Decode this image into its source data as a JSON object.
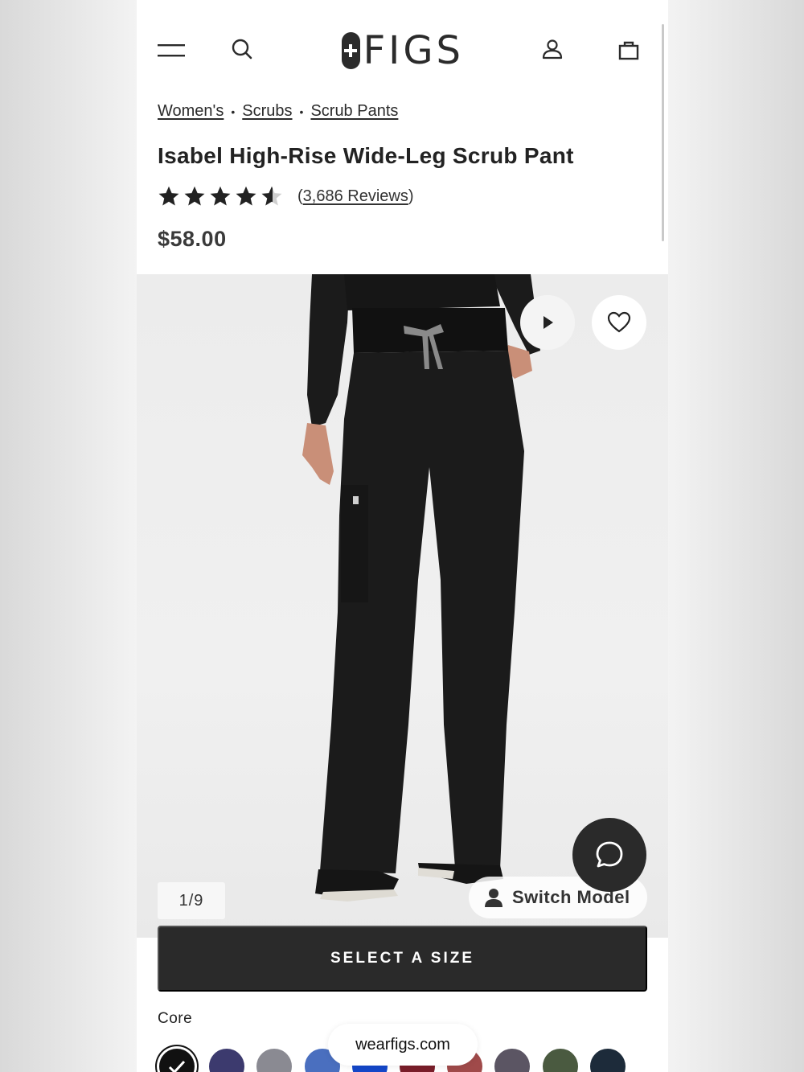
{
  "header": {
    "brand": "FIGS",
    "icons": [
      "menu-icon",
      "search-icon",
      "account-icon",
      "bag-icon"
    ]
  },
  "breadcrumb": [
    {
      "label": "Women's"
    },
    {
      "label": "Scrubs"
    },
    {
      "label": "Scrub Pants"
    }
  ],
  "product": {
    "title": "Isabel High-Rise Wide-Leg Scrub Pant",
    "rating": 4.5,
    "reviews_open": "(",
    "reviews_link": "3,686 Reviews",
    "reviews_close": ")",
    "price": "$58.00"
  },
  "gallery": {
    "counter": "1/9",
    "switch_model_label": "Switch Model",
    "product_color": "#1b1b1b"
  },
  "cta": {
    "select_size_label": "SELECT A SIZE"
  },
  "colors": {
    "section_label": "Core",
    "swatches": [
      "#111111",
      "#3c3a6e",
      "#8a8a92",
      "#4a6fbf",
      "#1447c9",
      "#7a1e2a",
      "#a04a4a",
      "#5b5563",
      "#4a5a40",
      "#1d2b3a"
    ]
  },
  "browser": {
    "url": "wearfigs.com"
  },
  "theme": {
    "accent": "#2a2a2a",
    "background": "#ffffff"
  }
}
